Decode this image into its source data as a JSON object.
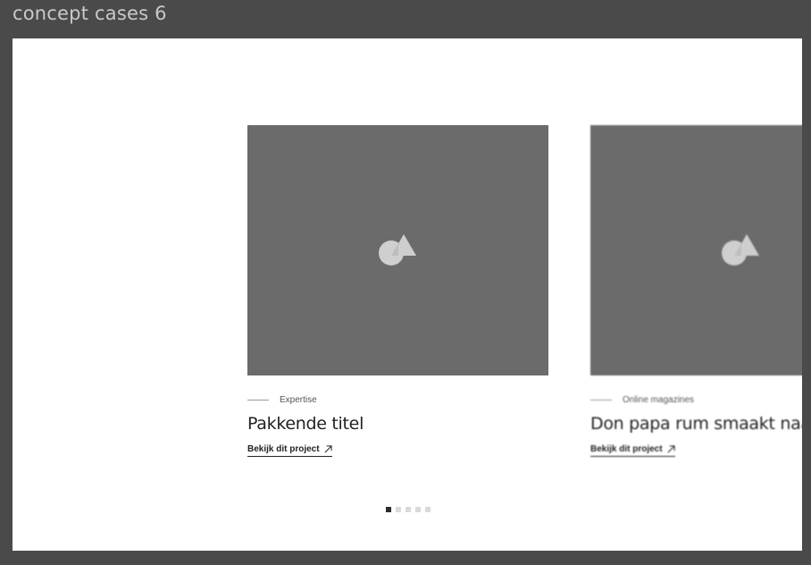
{
  "frame": {
    "title": "concept cases 6"
  },
  "cards": [
    {
      "category": "Expertise",
      "title": "Pakkende titel",
      "cta": "Bekijk dit project",
      "icon": "image-placeholder-icon"
    },
    {
      "category": "Online magazines",
      "title": "Don papa rum smaakt naar",
      "cta": "Bekijk dit project",
      "icon": "image-placeholder-icon"
    }
  ],
  "pagination": {
    "total": 5,
    "active_index": 0
  },
  "colors": {
    "background": "#4a4a4a",
    "canvas": "#ffffff",
    "thumb": "#6b6b6b",
    "dot_active": "#2b2b2b",
    "dot_inactive": "#d9d9d9"
  }
}
